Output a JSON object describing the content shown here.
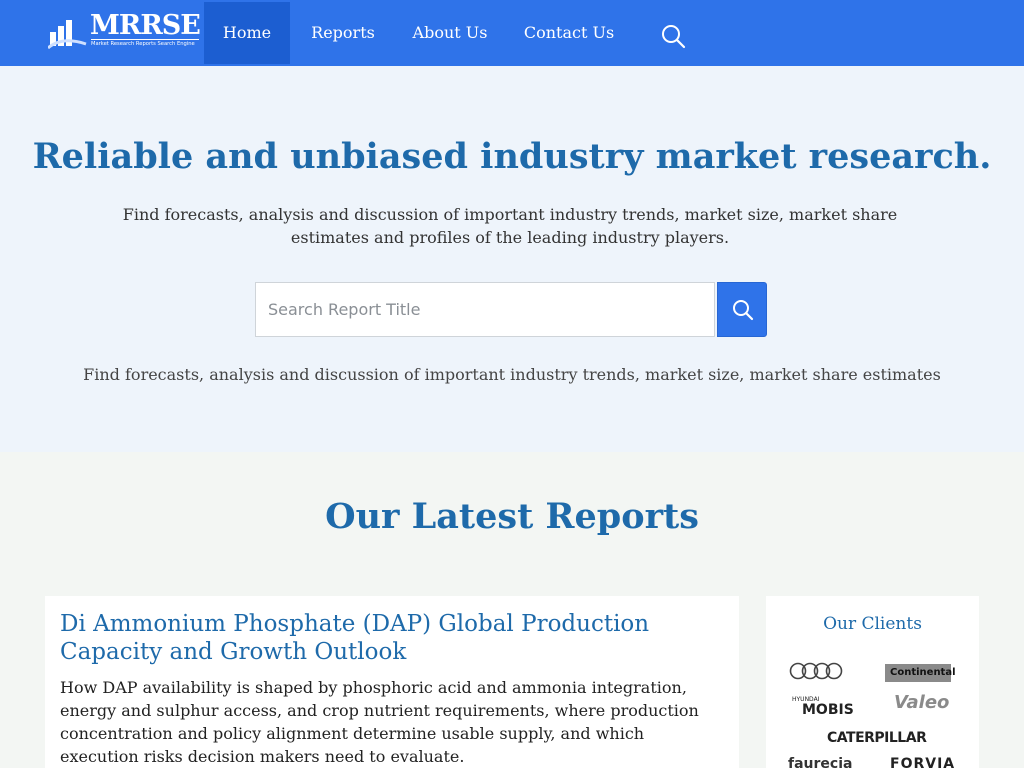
{
  "brand": {
    "name": "MRRSE",
    "tagline": "Market Research Reports Search Engine"
  },
  "nav": {
    "items": [
      {
        "label": "Home",
        "active": true
      },
      {
        "label": "Reports",
        "active": false
      },
      {
        "label": "About Us",
        "active": false
      },
      {
        "label": "Contact Us",
        "active": false
      }
    ],
    "search_icon": "search-icon"
  },
  "hero": {
    "title": "Reliable and unbiased industry market research.",
    "subtitle": "Find forecasts, analysis and discussion of important industry trends, market size, market share estimates and profiles of the leading industry players.",
    "search": {
      "placeholder": "Search Report Title",
      "value": "",
      "button_icon": "search-icon"
    },
    "subtitle2": "Find forecasts, analysis and discussion of important industry trends, market size, market share estimates"
  },
  "latest": {
    "title": "Our Latest Reports",
    "reports": [
      {
        "title": "Di Ammonium Phosphate (DAP) Global Production Capacity and Growth Outlook",
        "description": "How DAP availability is shaped by phosphoric acid and ammonia integration, energy and sulphur access, and crop nutrient requirements, where production concentration and policy alignment determine usable supply, and which execution risks decision makers need to evaluate."
      }
    ]
  },
  "clients": {
    "title": "Our Clients",
    "logos": [
      {
        "name": "audi-logo",
        "text": ""
      },
      {
        "name": "continental-logo",
        "text": "Continental"
      },
      {
        "name": "hyundai-mobis-logo",
        "text_top": "HYUNDAI",
        "text": "MOBIS"
      },
      {
        "name": "valeo-logo",
        "text": "Valeo"
      },
      {
        "name": "caterpillar-logo",
        "text": "CATERPILLAR"
      },
      {
        "name": "faurecia-logo",
        "text": "faurecia"
      },
      {
        "name": "forvia-logo",
        "text": "FORVIA"
      }
    ]
  },
  "colors": {
    "nav_bg": "#2f73e9",
    "nav_active": "#1c5ed1",
    "heading": "#1e6aaa",
    "hero_bg": "#eef4fb",
    "page_bg": "#f3f6f3"
  }
}
